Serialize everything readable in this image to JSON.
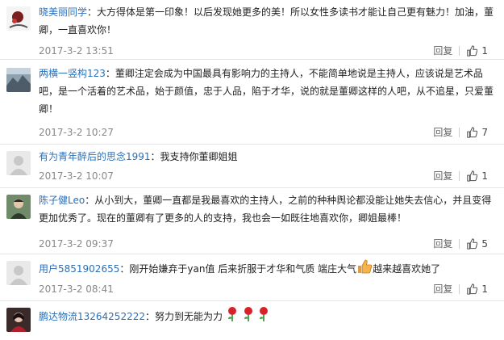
{
  "comments": [
    {
      "user": "晓美丽同学",
      "text": "：大方得体是第一印象！以后发现她更多的美！所以女性多读书才能让自己更有魅力！加油，董卿，一直喜欢你！",
      "time": "2017-3-2 13:51",
      "reply": "回复",
      "likes": "1"
    },
    {
      "user": "两横一竖构123",
      "text": "：董卿注定会成为中国最具有影响力的主持人，不能简单地说是主持人，应该说是艺术品吧，是一个活着的艺术品，始于颜值，忠于人品，陷于才华，说的就是董卿这样的人吧，从不追星，只爱董卿！",
      "time": "2017-3-2 10:27",
      "reply": "回复",
      "likes": "7"
    },
    {
      "user": "有为青年醉后的思念1991",
      "text": "：我支持你董卿姐姐",
      "time": "2017-3-2 10:07",
      "reply": "回复",
      "likes": "1"
    },
    {
      "user": "陈子健Leo",
      "text": "：从小到大，董卿一直都是我最喜欢的主持人，之前的种种舆论都没能让她失去信心，并且变得更加优秀了。现在的董卿有了更多的人的支持，我也会一如既往地喜欢你，卿姐最棒！",
      "time": "2017-3-2 09:37",
      "reply": "回复",
      "likes": "5"
    },
    {
      "user": "用户5851902655",
      "text_a": "：刚开始嫌弃于yan值 后来折服于才华和气质 端庄大气",
      "emoji_icon": "thumbs-up-emoji",
      "text_b": "越来越喜欢她了",
      "time": "2017-3-2 08:41",
      "reply": "回复",
      "likes": "1"
    },
    {
      "user": "鹏达物流13264252222",
      "text": "：努力到无能为力",
      "emoji_icon": "rose-emoji"
    }
  ],
  "colors": {
    "username": "#2a6fb8",
    "meta": "#888888",
    "divider": "#e5e5e5"
  }
}
